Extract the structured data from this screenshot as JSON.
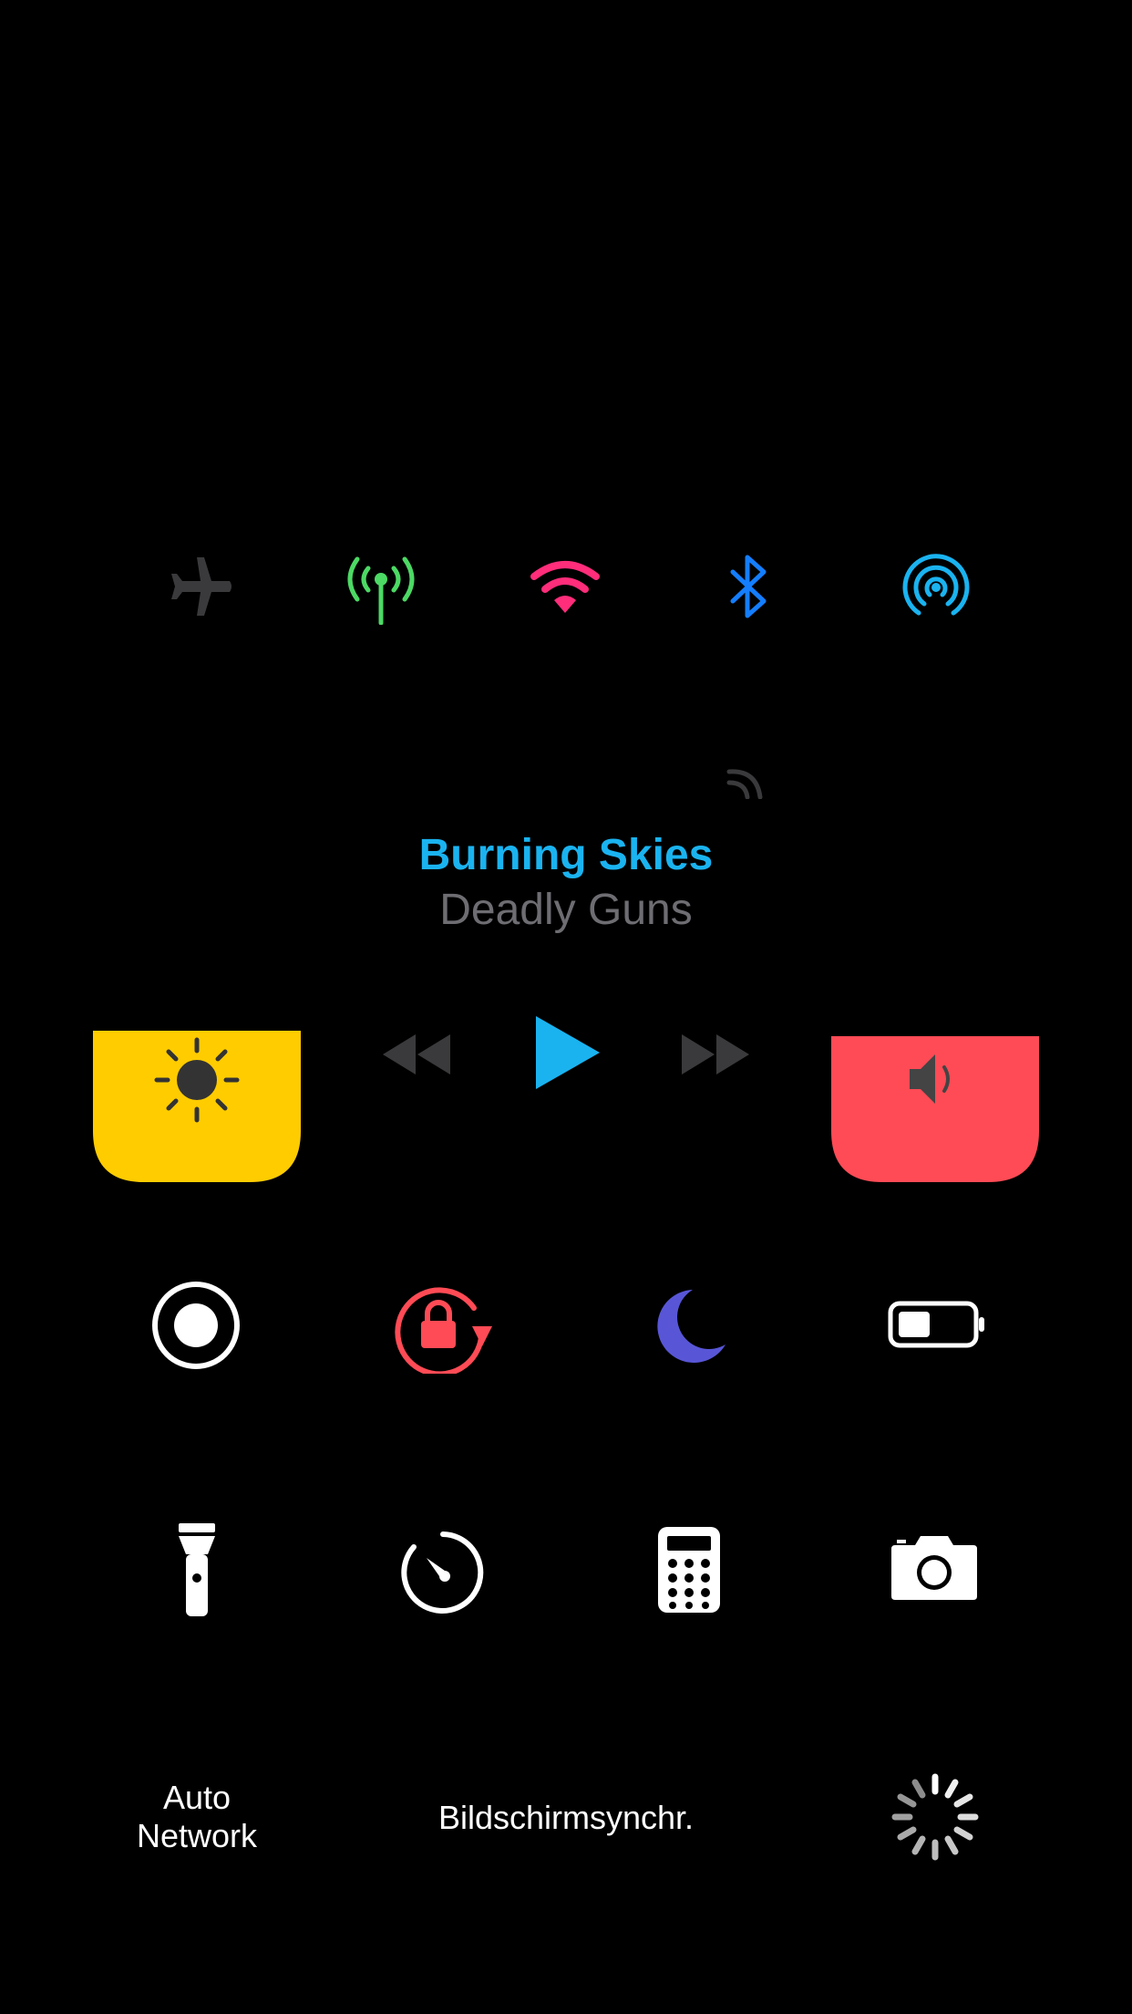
{
  "colors": {
    "background": "#000000",
    "airplane": "#3a3a3c",
    "cellular": "#4cd964",
    "wifi": "#ff2d7a",
    "bluetooth": "#147eff",
    "airdrop": "#1ab3f0",
    "brightness": "#ffcc00",
    "volume": "#ff4b55",
    "song_title": "#1ab3f0",
    "song_artist": "#6d6d72",
    "media_inactive": "#3a3a3c",
    "play": "#1ab3f0",
    "rotation_lock": "#ff4b55",
    "do_not_disturb": "#5856d6",
    "white": "#ffffff"
  },
  "connectivity": [
    {
      "name": "airplane-mode",
      "icon": "airplane-icon",
      "active": false
    },
    {
      "name": "cellular-data",
      "icon": "antenna-icon",
      "active": true
    },
    {
      "name": "wifi",
      "icon": "wifi-icon",
      "active": true
    },
    {
      "name": "bluetooth",
      "icon": "bluetooth-icon",
      "active": true
    },
    {
      "name": "airdrop",
      "icon": "airdrop-icon",
      "active": true
    }
  ],
  "now_playing": {
    "title": "Burning Skies",
    "artist": "Deadly Guns",
    "airplay_icon": "airplay-icon",
    "state": "paused"
  },
  "brightness": {
    "icon": "sun-icon",
    "level": 0.75
  },
  "volume": {
    "icon": "speaker-icon",
    "level": 0.72
  },
  "toggles": [
    {
      "name": "screen-recording",
      "icon": "record-icon"
    },
    {
      "name": "rotation-lock",
      "icon": "rotation-lock-icon"
    },
    {
      "name": "do-not-disturb",
      "icon": "moon-icon"
    },
    {
      "name": "low-power-mode",
      "icon": "battery-icon"
    }
  ],
  "shortcuts": [
    {
      "name": "flashlight",
      "icon": "flashlight-icon"
    },
    {
      "name": "timer",
      "icon": "timer-icon"
    },
    {
      "name": "calculator",
      "icon": "calculator-icon"
    },
    {
      "name": "camera",
      "icon": "camera-icon"
    }
  ],
  "bottom": {
    "auto_network_line1": "Auto",
    "auto_network_line2": "Network",
    "screen_mirroring": "Bildschirmsynchr.",
    "spinner_icon": "loading-spinner-icon"
  }
}
